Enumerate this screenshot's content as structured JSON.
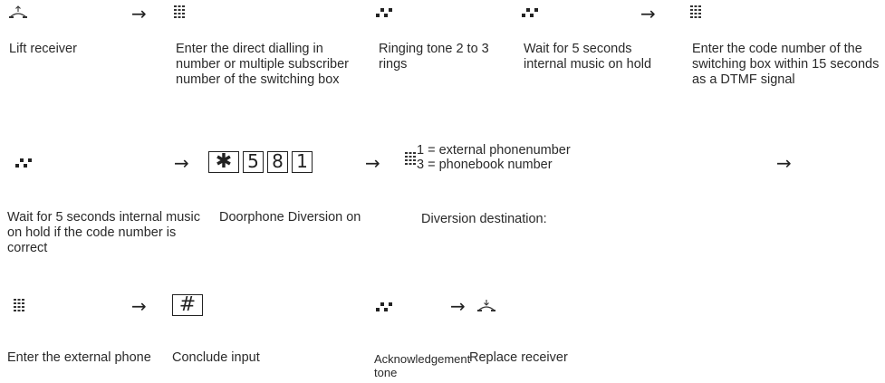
{
  "rows": [
    {
      "labels": [
        "Lift receiver",
        "Enter the direct dialling in number or multiple subscriber number of the switching box",
        "Ringing tone 2 to 3 rings",
        "Wait for 5 seconds internal music on hold",
        "Enter the code number of the switching box within 15 seconds as a DTMF signal"
      ],
      "icons": [
        "handset-lift-icon",
        "keypad-icon",
        "ring-tone-icon",
        "ring-tone-icon",
        "keypad-icon"
      ]
    },
    {
      "labels": [
        "Wait for 5 seconds internal music on hold if the code number is correct",
        "Doorphone Diversion on",
        "Diversion destination:"
      ],
      "keys": [
        "✱",
        "5",
        "8",
        "1"
      ],
      "options": [
        "1 = external phonenumber",
        "3 = phonebook number"
      ],
      "icons": [
        "ring-tone-icon",
        "keypad-icon"
      ]
    },
    {
      "labels": [
        "Enter the external phone",
        "Conclude input",
        "Acknowledgement tone",
        "Replace receiver"
      ],
      "keys": [
        "#"
      ],
      "icons": [
        "keypad-icon",
        "ring-tone-icon",
        "handset-replace-icon"
      ]
    }
  ],
  "arrow_symbol": "→"
}
